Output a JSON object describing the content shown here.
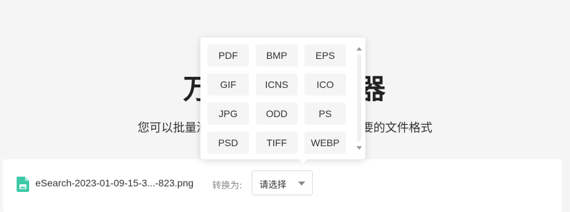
{
  "hero": {
    "title": "万能格式转换器",
    "subtitle": "您可以批量添加文件后，选择并转换成您需要的文件格式"
  },
  "file": {
    "icon": "image-file-icon",
    "icon_color": "#3ec9a7",
    "name": "eSearch-2023-01-09-15-3...-823.png",
    "convert_label": "转换为:",
    "select_value": "请选择"
  },
  "dropdown": {
    "options": [
      "PDF",
      "BMP",
      "EPS",
      "GIF",
      "ICNS",
      "ICO",
      "JPG",
      "ODD",
      "PS",
      "PSD",
      "TIFF",
      "WEBP"
    ]
  }
}
